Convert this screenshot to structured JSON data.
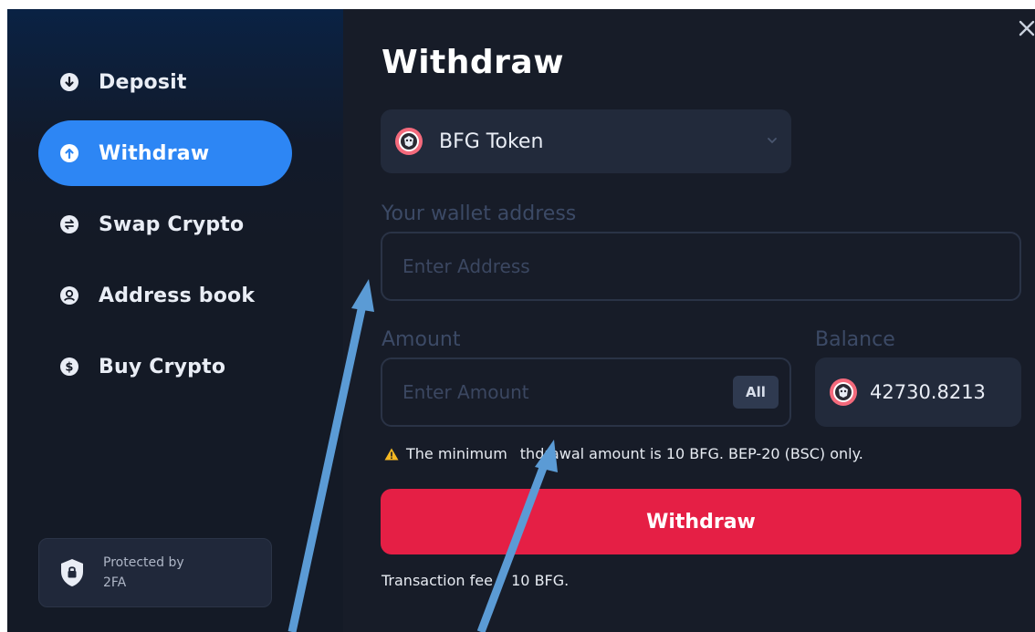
{
  "sidebar": {
    "items": [
      {
        "label": "Deposit",
        "icon": "arrow-down-circle-icon"
      },
      {
        "label": "Withdraw",
        "icon": "arrow-up-circle-icon",
        "active": true
      },
      {
        "label": "Swap Crypto",
        "icon": "swap-circle-icon"
      },
      {
        "label": "Address book",
        "icon": "user-circle-icon"
      },
      {
        "label": "Buy Crypto",
        "icon": "dollar-circle-icon"
      }
    ],
    "protected_label_line1": "Protected by",
    "protected_label_line2": "2FA"
  },
  "main": {
    "title": "Withdraw",
    "token": {
      "name": "BFG Token"
    },
    "wallet": {
      "label": "Your wallet address",
      "placeholder": "Enter Address"
    },
    "amount": {
      "label": "Amount",
      "placeholder": "Enter Amount",
      "all_label": "All"
    },
    "balance": {
      "label": "Balance",
      "value": "42730.8213"
    },
    "warning_prefix": "The minimum",
    "warning_suffix": "thdrawal amount is 10 BFG. BEP-20 (BSC) only.",
    "withdraw_button": "Withdraw",
    "fee_prefix": "Transaction fee",
    "fee_suffix": "10 BFG."
  },
  "colors": {
    "accent_blue": "#2d86f4",
    "withdraw_red": "#e51f45",
    "background": "#171c28",
    "annotation_arrow": "#5b9bd5"
  }
}
